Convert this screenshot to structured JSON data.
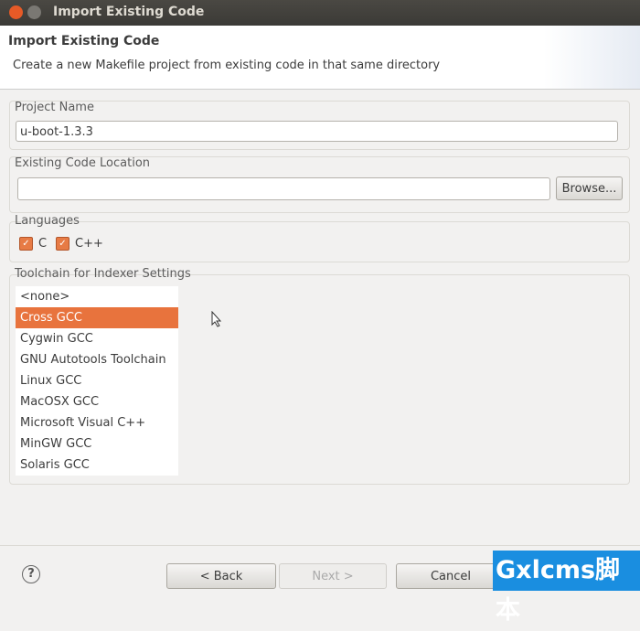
{
  "window": {
    "title": "Import Existing Code"
  },
  "header": {
    "title": "Import Existing Code",
    "description": "Create a new Makefile project from existing code in that same directory"
  },
  "project_name": {
    "label": "Project Name",
    "value": "u-boot-1.3.3"
  },
  "code_location": {
    "label": "Existing Code Location",
    "value": "",
    "browse_label": "Browse..."
  },
  "languages": {
    "label": "Languages",
    "items": [
      {
        "label": "C",
        "checked": true
      },
      {
        "label": "C++",
        "checked": true
      }
    ]
  },
  "toolchain": {
    "label": "Toolchain for Indexer Settings",
    "selected": "Cross GCC",
    "items": [
      "<none>",
      "Cross GCC",
      "Cygwin GCC",
      "GNU Autotools Toolchain",
      "Linux GCC",
      "MacOSX GCC",
      "Microsoft Visual C++",
      "MinGW GCC",
      "Solaris GCC"
    ]
  },
  "footer": {
    "help_icon": "?",
    "back_label": "< Back",
    "next_label": "Next >",
    "cancel_label": "Cancel"
  },
  "watermark": "Gxlcms脚本",
  "colors": {
    "accent": "#e8733d"
  }
}
